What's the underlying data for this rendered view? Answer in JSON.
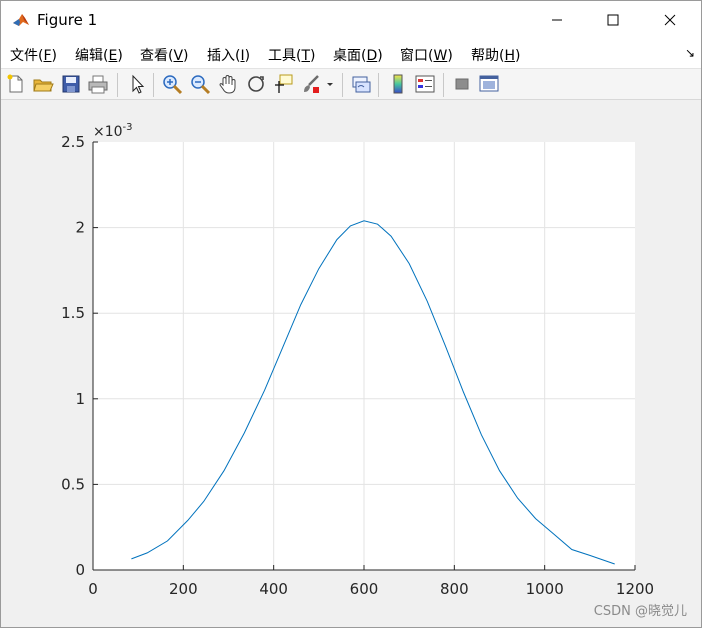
{
  "window": {
    "title": "Figure 1",
    "minimize_icon": "minimize-icon",
    "maximize_icon": "maximize-icon",
    "close_icon": "close-icon"
  },
  "menu": {
    "items": [
      {
        "text": "文件(",
        "acc": "F",
        "end": ")"
      },
      {
        "text": "编辑(",
        "acc": "E",
        "end": ")"
      },
      {
        "text": "查看(",
        "acc": "V",
        "end": ")"
      },
      {
        "text": "插入(",
        "acc": "I",
        "end": ")"
      },
      {
        "text": "工具(",
        "acc": "T",
        "end": ")"
      },
      {
        "text": "桌面(",
        "acc": "D",
        "end": ")"
      },
      {
        "text": "窗口(",
        "acc": "W",
        "end": ")"
      },
      {
        "text": "帮助(",
        "acc": "H",
        "end": ")"
      }
    ],
    "dock_arrow": "↘"
  },
  "toolbar": {
    "icons": [
      "new-figure-icon",
      "open-file-icon",
      "save-icon",
      "print-icon",
      "edit-plot-arrow-icon",
      "zoom-in-icon",
      "zoom-out-icon",
      "pan-hand-icon",
      "rotate-3d-icon",
      "data-cursor-icon",
      "brush-icon",
      "brush-dropdown-icon",
      "link-plot-icon",
      "colorbar-icon",
      "legend-icon",
      "hide-plot-tools-icon",
      "show-plot-tools-icon"
    ]
  },
  "chart_data": {
    "type": "line",
    "title": "",
    "xlabel": "",
    "ylabel": "",
    "y_exponent_label": "×10",
    "y_exponent_power": "-3",
    "xlim": [
      0,
      1200
    ],
    "ylim": [
      0,
      2.5
    ],
    "x_ticks": [
      "0",
      "200",
      "400",
      "600",
      "800",
      "1000",
      "1200"
    ],
    "y_ticks": [
      "0",
      "0.5",
      "1",
      "1.5",
      "2",
      "2.5"
    ],
    "x_tick_values": [
      0,
      200,
      400,
      600,
      800,
      1000,
      1200
    ],
    "y_tick_values": [
      0,
      0.5,
      1,
      1.5,
      2,
      2.5
    ],
    "grid": true,
    "line_color": "#0072bd",
    "series": [
      {
        "x": [
          85,
          120,
          165,
          210,
          245,
          290,
          335,
          380,
          420,
          460,
          500,
          540,
          570,
          600,
          630,
          660,
          700,
          740,
          780,
          820,
          860,
          900,
          940,
          980,
          1020,
          1060,
          1100,
          1155
        ],
        "y": [
          0.065,
          0.1,
          0.17,
          0.29,
          0.4,
          0.58,
          0.8,
          1.05,
          1.3,
          1.55,
          1.76,
          1.93,
          2.01,
          2.04,
          2.02,
          1.95,
          1.79,
          1.57,
          1.31,
          1.04,
          0.79,
          0.58,
          0.42,
          0.3,
          0.21,
          0.12,
          0.085,
          0.035
        ]
      }
    ]
  },
  "watermark": "CSDN @晓觉儿"
}
